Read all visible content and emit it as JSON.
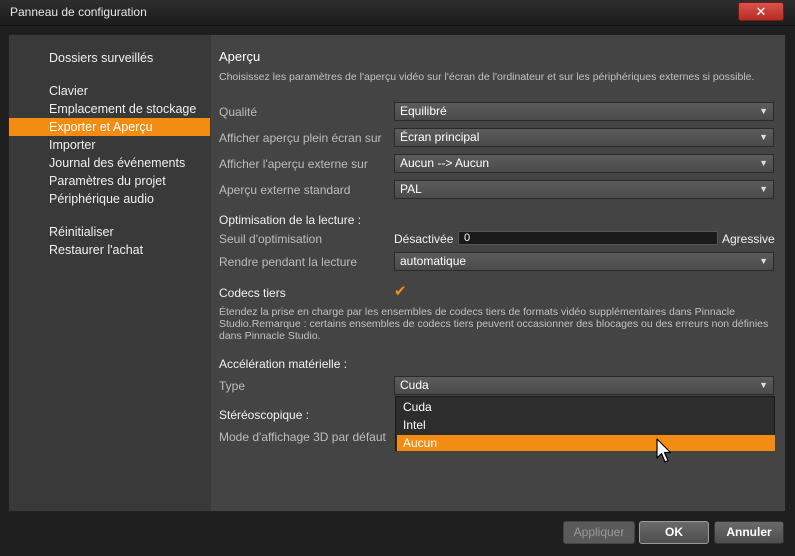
{
  "window": {
    "title": "Panneau de configuration",
    "close_glyph": "✕"
  },
  "sidebar": {
    "items": [
      {
        "label": "Dossiers surveillés"
      },
      {
        "label": "Clavier"
      },
      {
        "label": "Emplacement de stockage"
      },
      {
        "label": "Exporter et Aperçu",
        "active": true
      },
      {
        "label": "Importer"
      },
      {
        "label": "Journal des événements"
      },
      {
        "label": "Paramètres du projet"
      },
      {
        "label": "Périphérique audio"
      },
      {
        "label": "Réinitialiser"
      },
      {
        "label": "Restaurer l'achat"
      }
    ]
  },
  "preview": {
    "title": "Aperçu",
    "description": "Choisissez les paramètres de l'aperçu vidéo sur l'écran de l'ordinateur et sur les périphériques externes si possible.",
    "quality": {
      "label": "Qualité",
      "value": "Equilibré"
    },
    "fullscreen": {
      "label": "Afficher aperçu plein écran sur",
      "value": "Écran principal"
    },
    "external": {
      "label": "Afficher l'aperçu externe sur",
      "value": "Aucun --> Aucun"
    },
    "external_standard": {
      "label": "Aperçu externe standard",
      "value": "PAL"
    }
  },
  "playback": {
    "title": "Optimisation de la lecture :",
    "threshold": {
      "label": "Seuil d'optimisation",
      "min_label": "Désactivée",
      "max_label": "Agressive",
      "value": "0"
    },
    "render": {
      "label": "Rendre pendant la lecture",
      "value": "automatique"
    }
  },
  "codecs": {
    "label": "Codecs tiers",
    "checked": true,
    "description": "Étendez la prise en charge par les ensembles de codecs tiers de formats vidéo supplémentaires dans Pinnacle Studio.Remarque : certains ensembles de codecs tiers peuvent occasionner des blocages ou des erreurs non définies dans Pinnacle Studio."
  },
  "hardware": {
    "title": "Accélération matérielle :",
    "type": {
      "label": "Type",
      "value": "Cuda",
      "options": [
        "Cuda",
        "Intel",
        "Aucun"
      ],
      "highlighted": "Aucun"
    }
  },
  "stereo": {
    "title": "Stéréoscopique :",
    "mode_label": "Mode d'affichage 3D par défaut"
  },
  "buttons": {
    "apply": "Appliquer",
    "ok": "OK",
    "cancel": "Annuler"
  },
  "colors": {
    "accent": "#f28c13",
    "panel": "#444444",
    "sidebar": "#393939"
  }
}
